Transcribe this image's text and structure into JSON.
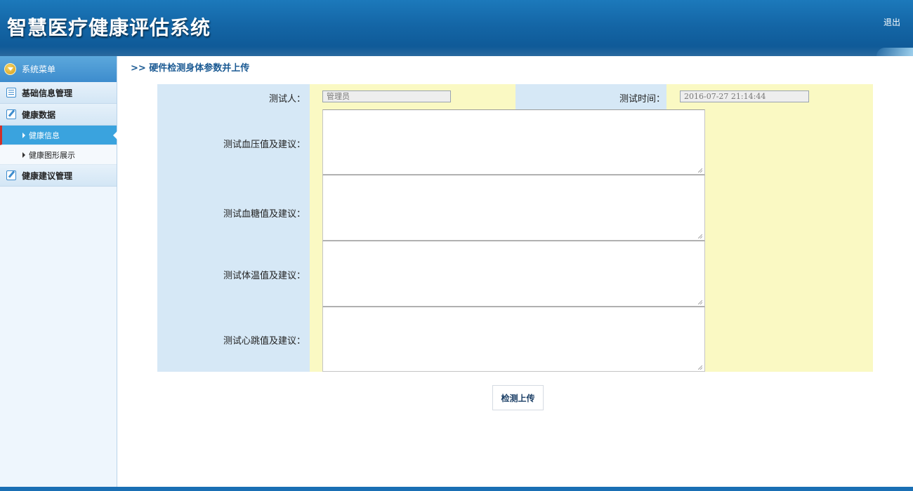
{
  "header": {
    "title": "智慧医疗健康评估系统",
    "logout_label": "退出"
  },
  "sidebar": {
    "menu_title": "系统菜单",
    "groups": [
      {
        "label": "基础信息管理",
        "icon": "list-icon"
      },
      {
        "label": "健康数据",
        "icon": "edit-icon",
        "items": [
          {
            "label": "健康信息",
            "active": true
          },
          {
            "label": "健康图形展示",
            "active": false
          }
        ]
      },
      {
        "label": "健康建议管理",
        "icon": "edit-icon"
      }
    ]
  },
  "main": {
    "breadcrumb": ">> 硬件检测身体参数并上传",
    "form": {
      "tester_label": "测试人：",
      "tester_value": "管理员",
      "time_label": "测试时间：",
      "time_value": "2016-07-27 21:14:44",
      "blood_pressure_label": "测试血压值及建议：",
      "blood_sugar_label": "测试血糖值及建议：",
      "temperature_label": "测试体温值及建议：",
      "heartbeat_label": "测试心跳值及建议："
    },
    "submit_label": "检测上传"
  },
  "colors": {
    "header_blue": "#1466a6",
    "label_bg": "#d6e8f6",
    "field_bg": "#faf9c3",
    "active_menu": "#3aa3de"
  }
}
